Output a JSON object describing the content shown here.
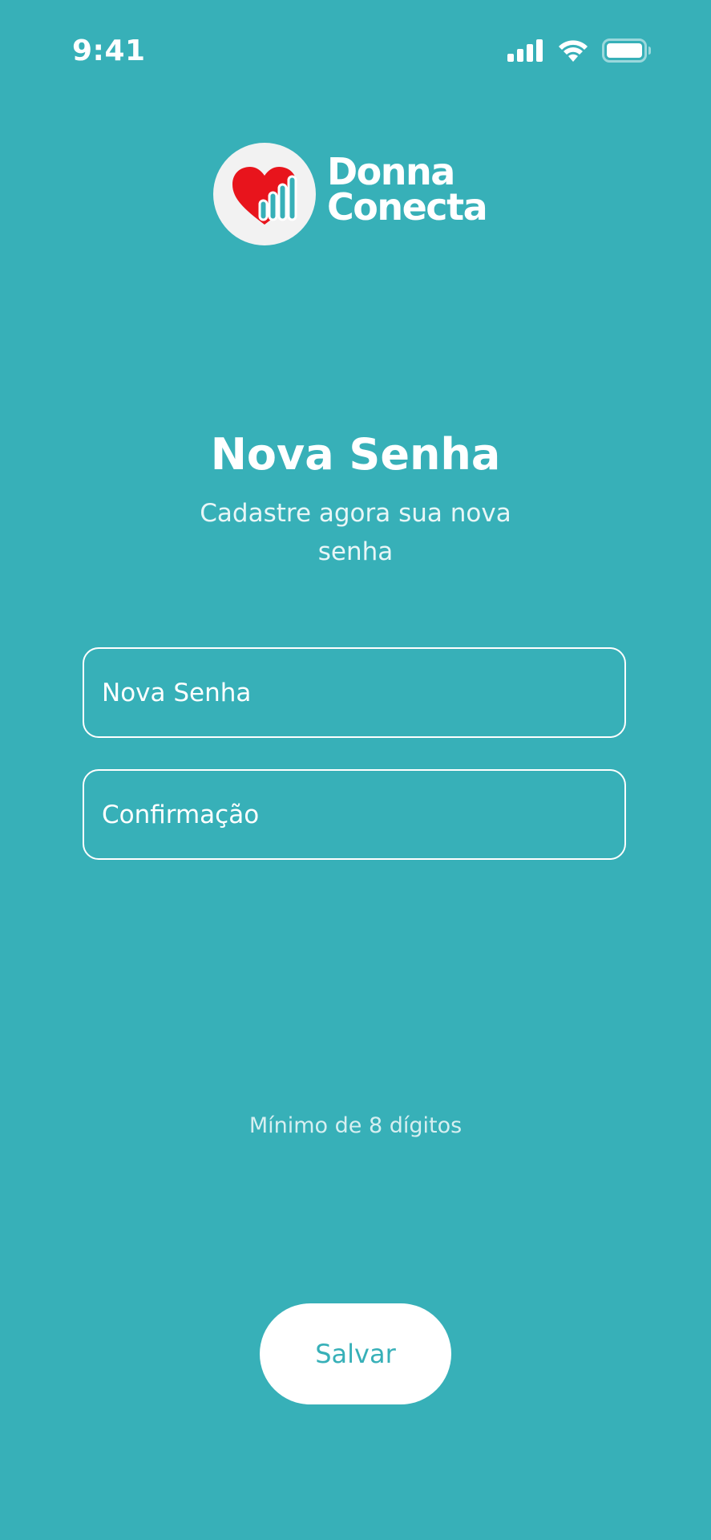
{
  "status_bar": {
    "time": "9:41",
    "icons": [
      "cellular-signal-icon",
      "wifi-icon",
      "battery-icon"
    ]
  },
  "logo": {
    "line1": "Donna",
    "line2": "Conecta",
    "icon": "heart-signal-icon"
  },
  "header": {
    "title": "Nova Senha",
    "subtitle": "Cadastre agora sua nova senha"
  },
  "form": {
    "new_password_placeholder": "Nova Senha",
    "confirmation_placeholder": "Confirmação",
    "hint": "Mínimo de 8 dígitos",
    "save_label": "Salvar"
  },
  "colors": {
    "background": "#37b0b8",
    "accent": "#37b0b8",
    "heart": "#e8141c",
    "text": "#ffffff"
  }
}
